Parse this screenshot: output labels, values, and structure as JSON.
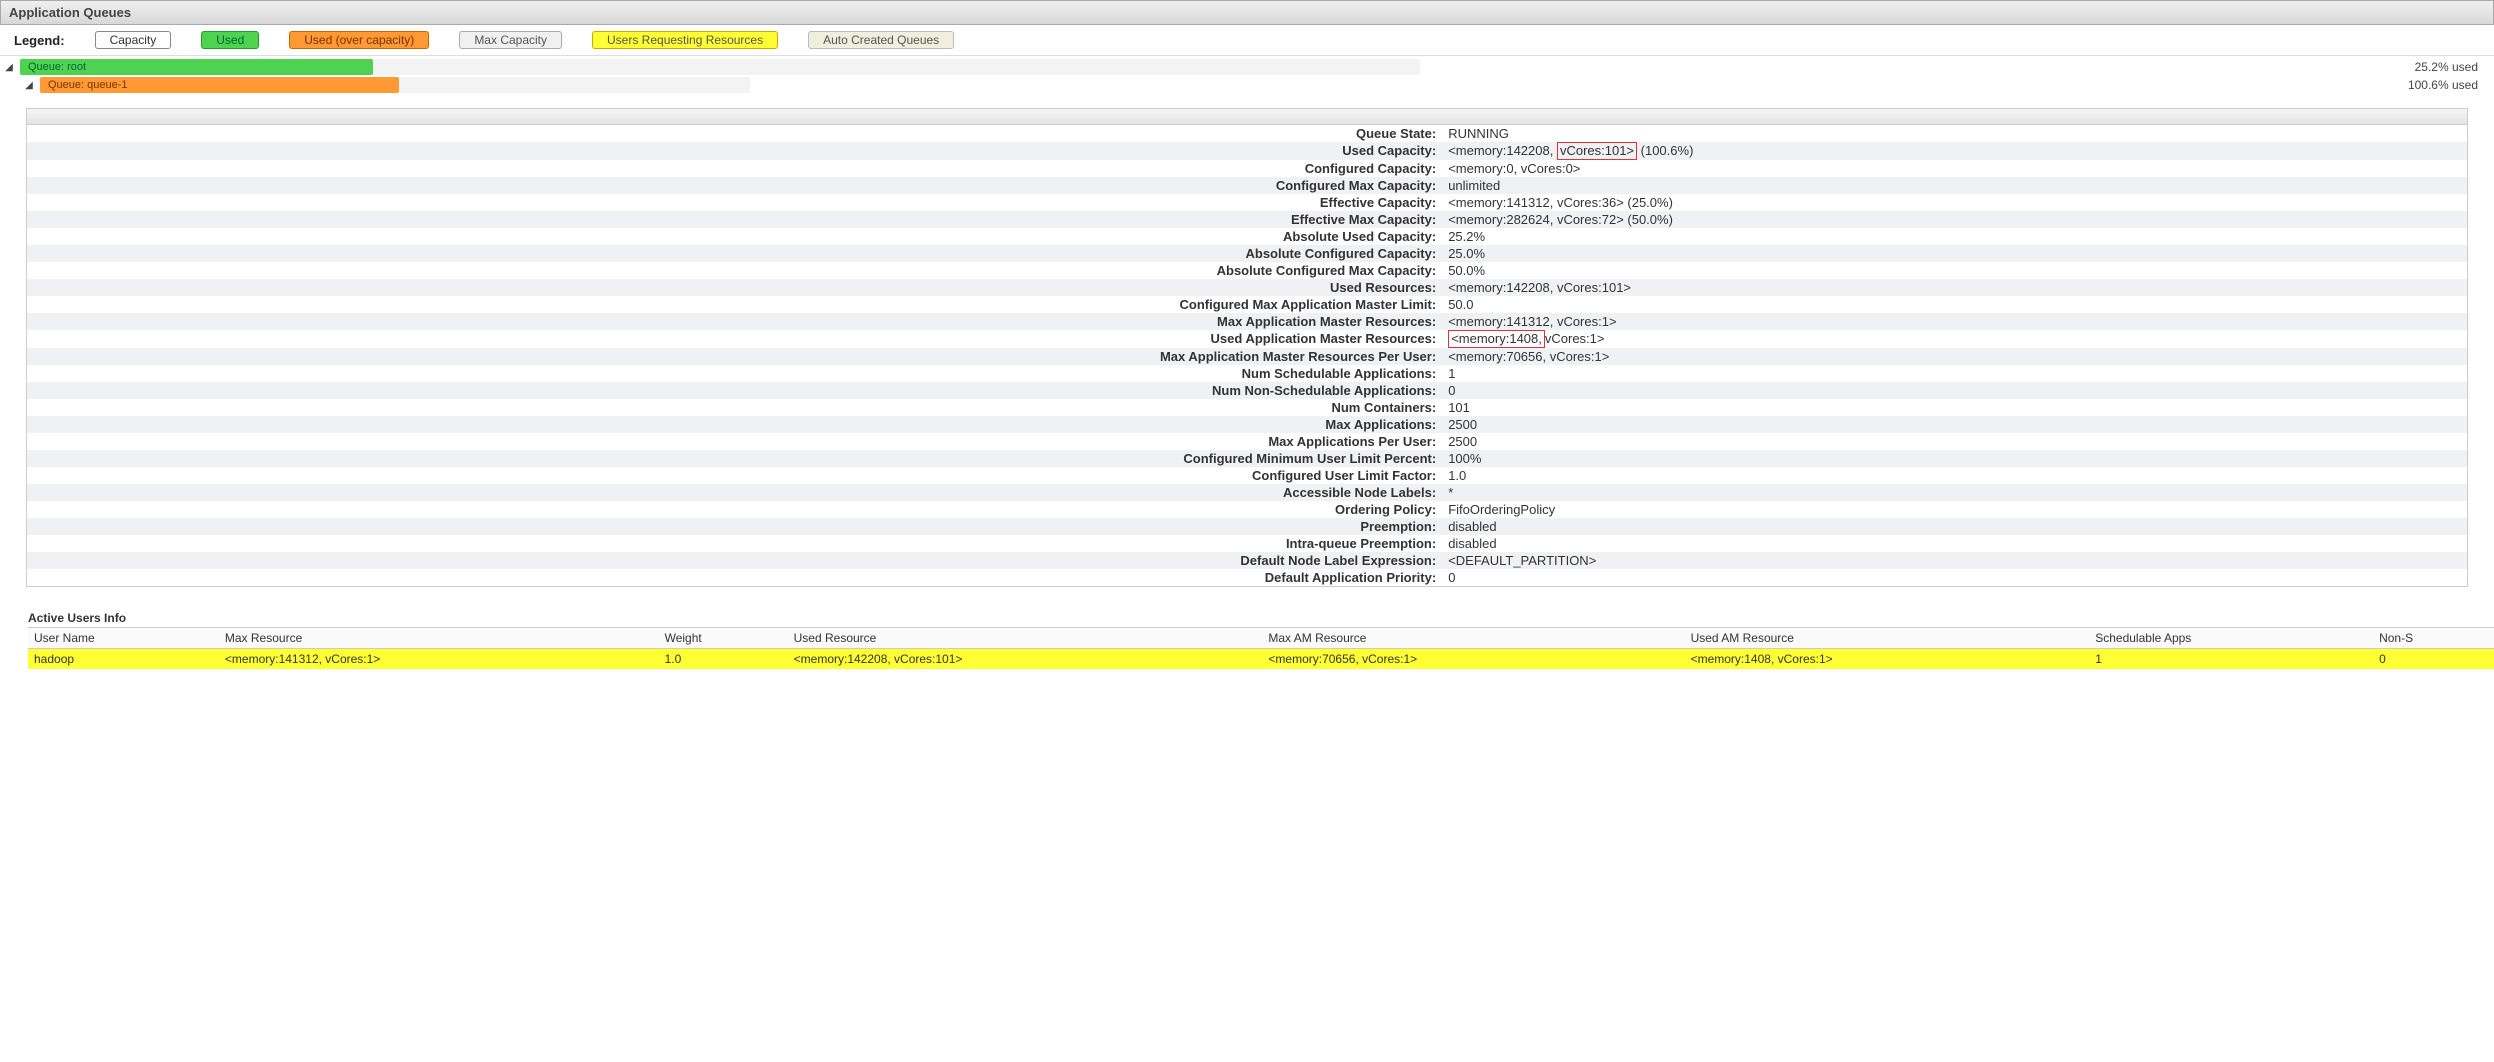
{
  "header": {
    "title": "Application Queues"
  },
  "legend": {
    "label": "Legend:",
    "capacity": "Capacity",
    "used": "Used",
    "used_over": "Used (over capacity)",
    "max_capacity": "Max Capacity",
    "users_requesting": "Users Requesting Resources",
    "auto_created": "Auto Created Queues"
  },
  "queues": [
    {
      "name": "Queue: root",
      "fill_pct": 25.2,
      "fill_style": "green",
      "indent": 0,
      "usage_text": "25.2% used",
      "bar_flex": 1400
    },
    {
      "name": "Queue: queue-1",
      "fill_pct": 50.6,
      "fill_style": "orange",
      "indent": 1,
      "usage_text": "100.6% used",
      "bar_flex": 710
    }
  ],
  "details": [
    {
      "k": "Queue State:",
      "v": "RUNNING"
    },
    {
      "k": "Used Capacity:",
      "v_pre": "<memory:142208, ",
      "v_box": "vCores:101>",
      "v_post": " (100.6%)"
    },
    {
      "k": "Configured Capacity:",
      "v": "<memory:0, vCores:0>"
    },
    {
      "k": "Configured Max Capacity:",
      "v": "unlimited"
    },
    {
      "k": "Effective Capacity:",
      "v": "<memory:141312, vCores:36> (25.0%)"
    },
    {
      "k": "Effective Max Capacity:",
      "v": "<memory:282624, vCores:72> (50.0%)"
    },
    {
      "k": "Absolute Used Capacity:",
      "v": "25.2%"
    },
    {
      "k": "Absolute Configured Capacity:",
      "v": "25.0%"
    },
    {
      "k": "Absolute Configured Max Capacity:",
      "v": "50.0%"
    },
    {
      "k": "Used Resources:",
      "v": "<memory:142208, vCores:101>"
    },
    {
      "k": "Configured Max Application Master Limit:",
      "v": "50.0"
    },
    {
      "k": "Max Application Master Resources:",
      "v": "<memory:141312, vCores:1>"
    },
    {
      "k": "Used Application Master Resources:",
      "v_box": "<memory:1408, ",
      "v_post": "vCores:1>"
    },
    {
      "k": "Max Application Master Resources Per User:",
      "v": "<memory:70656, vCores:1>"
    },
    {
      "k": "Num Schedulable Applications:",
      "v": "1"
    },
    {
      "k": "Num Non-Schedulable Applications:",
      "v": "0"
    },
    {
      "k": "Num Containers:",
      "v": "101"
    },
    {
      "k": "Max Applications:",
      "v": "2500"
    },
    {
      "k": "Max Applications Per User:",
      "v": "2500"
    },
    {
      "k": "Configured Minimum User Limit Percent:",
      "v": "100%"
    },
    {
      "k": "Configured User Limit Factor:",
      "v": "1.0"
    },
    {
      "k": "Accessible Node Labels:",
      "v": "*"
    },
    {
      "k": "Ordering Policy:",
      "v": "FifoOrderingPolicy"
    },
    {
      "k": "Preemption:",
      "v": "disabled"
    },
    {
      "k": "Intra-queue Preemption:",
      "v": "disabled"
    },
    {
      "k": "Default Node Label Expression:",
      "v": "<DEFAULT_PARTITION>"
    },
    {
      "k": "Default Application Priority:",
      "v": "0"
    }
  ],
  "users_info": {
    "title": "Active Users Info",
    "columns": [
      "User Name",
      "Max Resource",
      "Weight",
      "Used Resource",
      "Max AM Resource",
      "Used AM Resource",
      "Schedulable Apps",
      "Non-S"
    ],
    "rows": [
      {
        "hl": true,
        "cells": [
          "hadoop",
          "<memory:141312, vCores:1>",
          "1.0",
          "<memory:142208, vCores:101>",
          "<memory:70656, vCores:1>",
          "<memory:1408, vCores:1>",
          "1",
          "0"
        ]
      }
    ]
  },
  "watermark": ""
}
